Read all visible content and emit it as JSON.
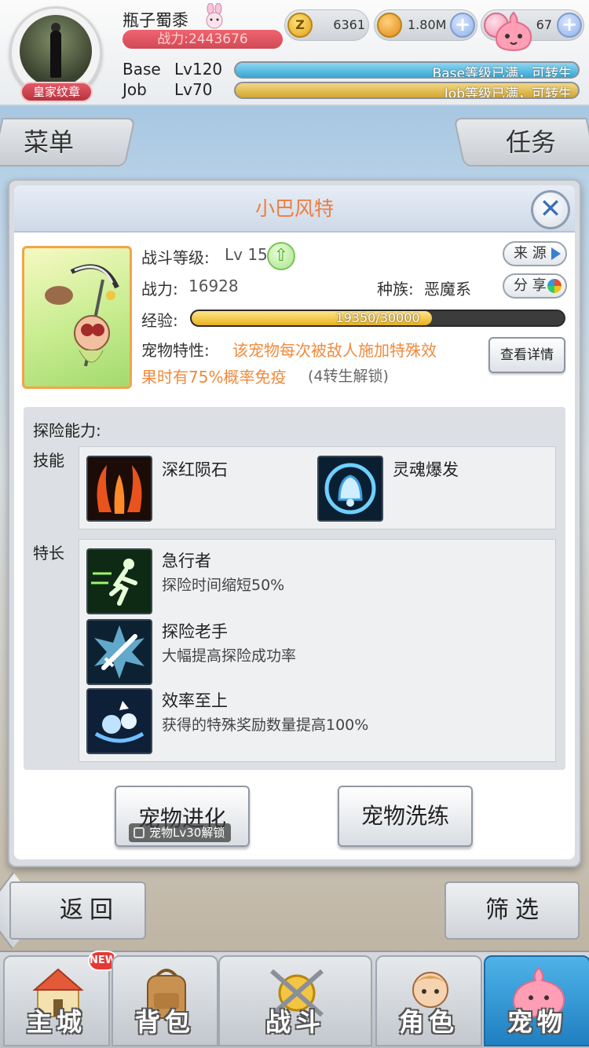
{
  "player": {
    "name": "瓶子蜀黍",
    "power": "战力:2443676",
    "badge": "皇家纹章",
    "base_label": "Base",
    "base_level": "Lv120",
    "base_bar_text": "Base等级已满，可转生",
    "job_label": "Job",
    "job_level": "Lv70",
    "job_bar_text": "Job等级已满，可转生"
  },
  "currency": {
    "zeny_icon": "Z",
    "zeny": "6361",
    "coin": "1.80M",
    "gem": "67"
  },
  "tabs": {
    "menu": "菜单",
    "task": "任务"
  },
  "pet": {
    "name": "小巴风特",
    "battle_level_label": "战斗等级:",
    "battle_level": "Lv 15",
    "power_label": "战力:",
    "power": "16928",
    "race_label": "种族:",
    "race": "恶魔系",
    "exp_label": "经验:",
    "exp_text": "19350/30000",
    "exp_fraction": 0.645,
    "trait_label": "宠物特性:",
    "trait_line1": "该宠物每次被敌人施加特殊效",
    "trait_line2": "果时有75%概率免疫",
    "trait_unlock": "(4转生解锁)",
    "source_button": "来 源",
    "share_button": "分 享",
    "detail_button": "查看详情"
  },
  "explore": {
    "title": "探险能力:",
    "skills_label": "技能",
    "skills": [
      {
        "name": "深红陨石",
        "icon": "crimson-meteor-icon"
      },
      {
        "name": "灵魂爆发",
        "icon": "soul-burst-icon"
      }
    ],
    "traits_label": "特长",
    "traits": [
      {
        "name": "急行者",
        "desc": "探险时间缩短50%",
        "icon": "sprinter-icon"
      },
      {
        "name": "探险老手",
        "desc": "大幅提高探险成功率",
        "icon": "veteran-sword-icon"
      },
      {
        "name": "效率至上",
        "desc": "获得的特殊奖励数量提高100%",
        "icon": "efficiency-icon"
      }
    ]
  },
  "actions": {
    "evolve": "宠物进化",
    "evolve_lock": "宠物Lv30解锁",
    "refine": "宠物洗练"
  },
  "nav": {
    "back": "返回",
    "filter": "筛选",
    "new_badge": "NEW",
    "tabs": [
      "主城",
      "背包",
      "战斗",
      "角色",
      "宠物"
    ]
  },
  "colors": {
    "accent_orange": "#f08a3c",
    "active_tab": "#1f7fc1",
    "exp_fill": "#e8b21e"
  }
}
